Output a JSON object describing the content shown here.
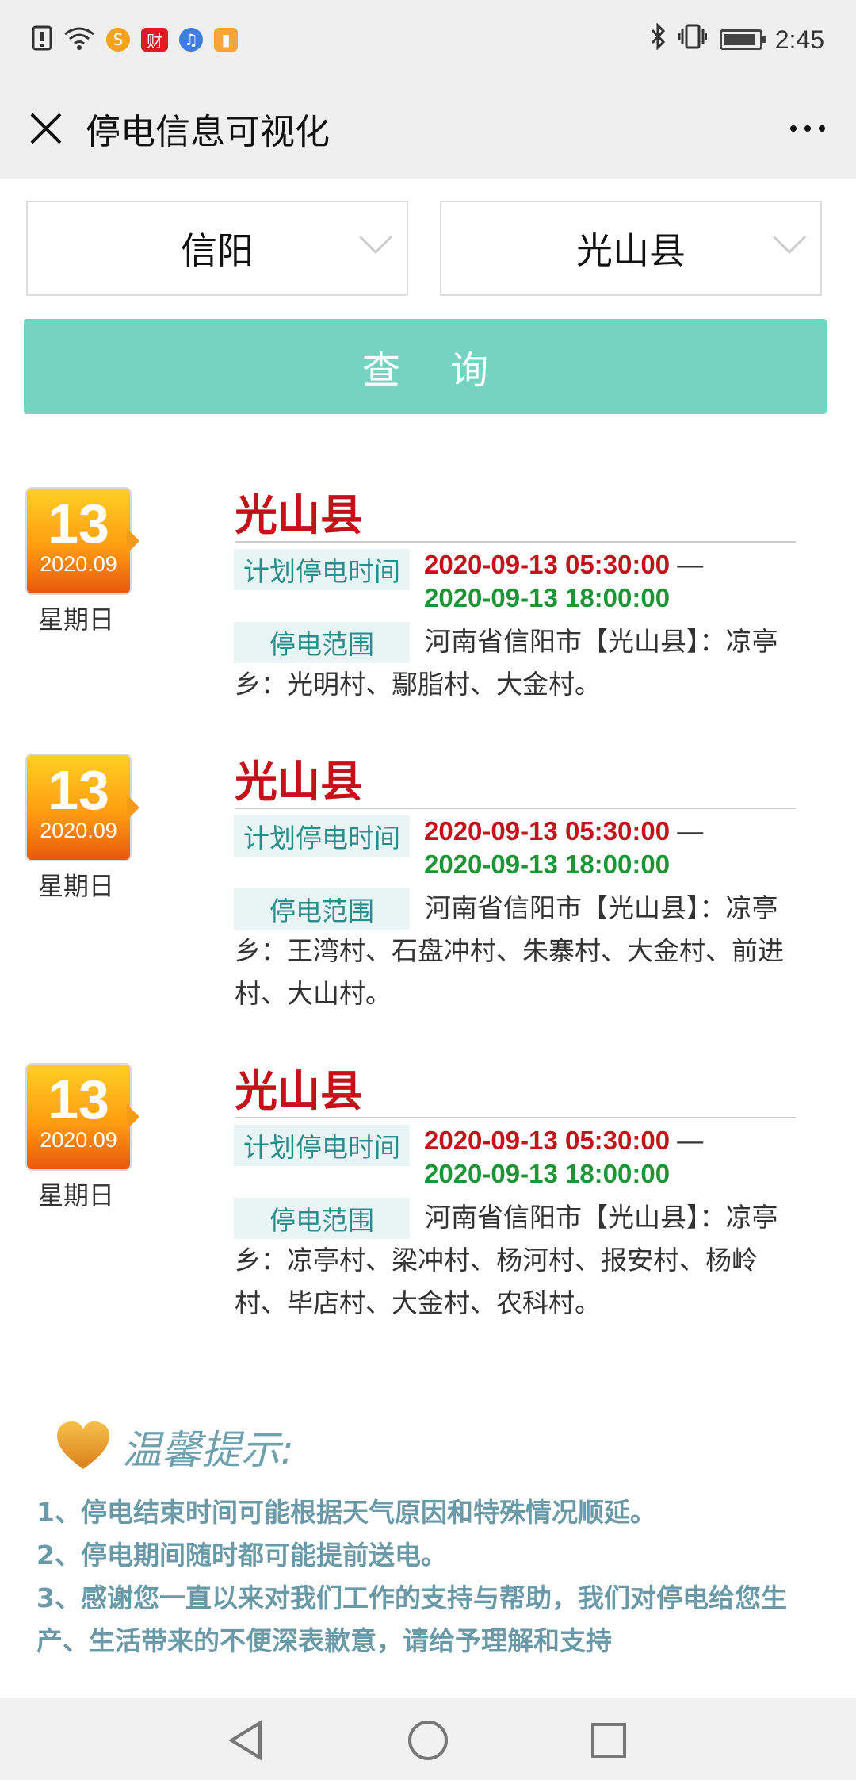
{
  "status_bar": {
    "time": "2:45",
    "left_icons": [
      "alert-icon",
      "wifi-icon",
      "sogou-icon",
      "finance-app-icon",
      "music-icon",
      "orange-app-icon"
    ],
    "right_icons": [
      "bluetooth-icon",
      "vibrate-icon",
      "battery-icon"
    ]
  },
  "header": {
    "title": "停电信息可视化"
  },
  "filters": {
    "city": "信阳",
    "county": "光山县",
    "query_label": "查 询"
  },
  "labels": {
    "plan_time": "计划停电时间",
    "scope": "停电范围",
    "dash": " —"
  },
  "records": [
    {
      "day": "13",
      "month": "2020.09",
      "weekday": "星期日",
      "county": "光山县",
      "start": "2020-09-13 05:30:00",
      "end": "2020-09-13 18:00:00",
      "scope": "河南省信阳市【光山县】：凉亭乡：光明村、鄢脂村、大金村。"
    },
    {
      "day": "13",
      "month": "2020.09",
      "weekday": "星期日",
      "county": "光山县",
      "start": "2020-09-13 05:30:00",
      "end": "2020-09-13 18:00:00",
      "scope": "河南省信阳市【光山县】：凉亭乡：王湾村、石盘冲村、朱寨村、大金村、前进村、大山村。"
    },
    {
      "day": "13",
      "month": "2020.09",
      "weekday": "星期日",
      "county": "光山县",
      "start": "2020-09-13 05:30:00",
      "end": "2020-09-13 18:00:00",
      "scope": "河南省信阳市【光山县】：凉亭乡：凉亭村、梁冲村、杨河村、报安村、杨岭村、毕店村、大金村、农科村。"
    }
  ],
  "tips": {
    "title": "温馨提示:",
    "items": [
      "1、停电结束时间可能根据天气原因和特殊情况顺延。",
      "2、停电期间随时都可能提前送电。",
      "3、感谢您一直以来对我们工作的支持与帮助，我们对停电给您生产、生活带来的不便深表歉意，请给予理解和支持"
    ]
  },
  "colors": {
    "accent": "#74d3c1",
    "red": "#c4121b",
    "green": "#1d9435",
    "tip": "#6a9aa8"
  }
}
